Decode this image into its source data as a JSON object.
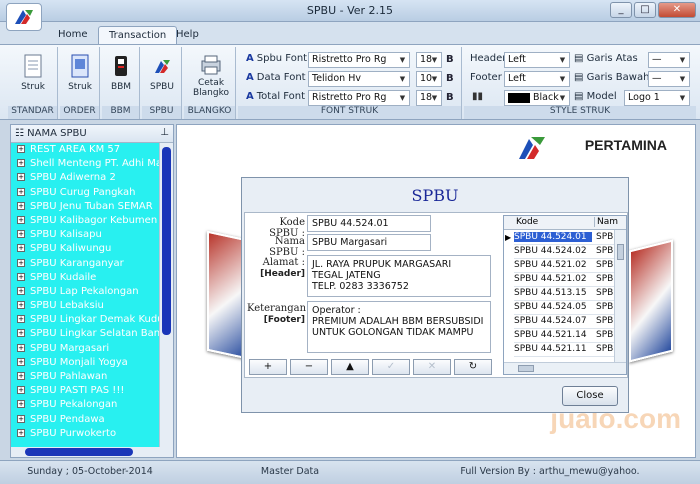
{
  "window": {
    "title": "SPBU - Ver 2.15"
  },
  "tabs": [
    {
      "label": "Home"
    },
    {
      "label": "Transaction"
    },
    {
      "label": "Help"
    }
  ],
  "ribbon": {
    "groups": {
      "standar": {
        "label": "STANDAR",
        "button": "Struk"
      },
      "order": {
        "label": "ORDER",
        "button": "Struk"
      },
      "bbm": {
        "label": "BBM",
        "button": "BBM"
      },
      "spbu": {
        "label": "SPBU",
        "button": "SPBU"
      },
      "blangko": {
        "label": "BLANGKO",
        "button_line1": "Cetak",
        "button_line2": "Blangko"
      },
      "font_struk": {
        "label": "FONT STRUK",
        "rows": [
          {
            "label": "Spbu Font",
            "font": "Ristretto Pro Rg",
            "size": "18",
            "bold": "B"
          },
          {
            "label": "Data Font",
            "font": "Telidon Hv",
            "size": "10",
            "bold": "B"
          },
          {
            "label": "Total Font",
            "font": "Ristretto Pro Rg",
            "size": "18",
            "bold": "B"
          }
        ]
      },
      "style_struk": {
        "label": "STYLE STRUK",
        "header_label": "Header",
        "header_value": "Left",
        "footer_label": "Footer",
        "footer_value": "Left",
        "color_value": "Black",
        "garis_atas_label": "Garis Atas",
        "garis_atas_value": "—",
        "garis_bawah_label": "Garis Bawah",
        "garis_bawah_value": "—",
        "model_label": "Model",
        "model_value": "Logo 1"
      }
    }
  },
  "sidebar": {
    "title": "NAMA SPBU",
    "items": [
      "REST AREA KM 57",
      "Shell Menteng PT. Adhi Ma",
      "SPBU Adiwerna 2",
      "SPBU Curug Pangkah",
      "SPBU Jenu Tuban SEMAR",
      "SPBU Kalibagor Kebumen",
      "SPBU Kalisapu",
      "SPBU Kaliwungu",
      "SPBU Karanganyar",
      "SPBU Kudaile",
      "SPBU Lap Pekalongan",
      "SPBU Lebaksiu",
      "SPBU Lingkar Demak Kudu",
      "SPBU Lingkar Selatan Bant",
      "SPBU Margasari",
      "SPBU Monjali Yogya",
      "SPBU Pahlawan",
      "SPBU PASTI PAS !!!",
      "SPBU Pekalongan",
      "SPBU Pendawa",
      "SPBU Purwokerto"
    ]
  },
  "brand": {
    "name": "PERTAMINA",
    "watermark": "jualo.com"
  },
  "dialog": {
    "title": "SPBU",
    "kode_label": "Kode SPBU :",
    "kode_value": "SPBU 44.524.01",
    "nama_label": "Nama SPBU :",
    "nama_value": "SPBU Margasari",
    "alamat_label": "Alamat :",
    "header_tag": "[Header]",
    "alamat_lines": [
      "JL. RAYA PRUPUK MARGASARI",
      "TEGAL JATENG",
      "TELP. 0283 3336752"
    ],
    "keterangan_label": "Keterangan :",
    "footer_tag": "[Footer]",
    "keterangan_lines": [
      "Operator :",
      "PREMIUM ADALAH BBM BERSUBSIDI",
      "UNTUK GOLONGAN TIDAK MAMPU"
    ],
    "nav_buttons": [
      "+",
      "−",
      "▲",
      "✓",
      "✕",
      "↻"
    ],
    "close_label": "Close",
    "grid": {
      "col_kode": "Kode",
      "col_nama": "Nam",
      "rows": [
        {
          "kode": "SPBU 44.524.01",
          "nama": "SPB"
        },
        {
          "kode": "SPBU 44.524.02",
          "nama": "SPB"
        },
        {
          "kode": "SPBU 44.521.02",
          "nama": "SPB"
        },
        {
          "kode": "SPBU 44.521.02",
          "nama": "SPB"
        },
        {
          "kode": "SPBU 44.513.15",
          "nama": "SPB"
        },
        {
          "kode": "SPBU 44.524.05",
          "nama": "SPB"
        },
        {
          "kode": "SPBU 44.524.07",
          "nama": "SPB"
        },
        {
          "kode": "SPBU 44.521.14",
          "nama": "SPB"
        },
        {
          "kode": "SPBU 44.521.11",
          "nama": "SPB"
        }
      ]
    }
  },
  "status": {
    "date": "Sunday ; 05-October-2014",
    "section": "Master Data",
    "version": "Full Version By : arthu_mewu@yahoo."
  },
  "colors": {
    "accent": "#1a2898",
    "sidebar_bg": "#28f0f0",
    "selection": "#2d5fd3"
  }
}
